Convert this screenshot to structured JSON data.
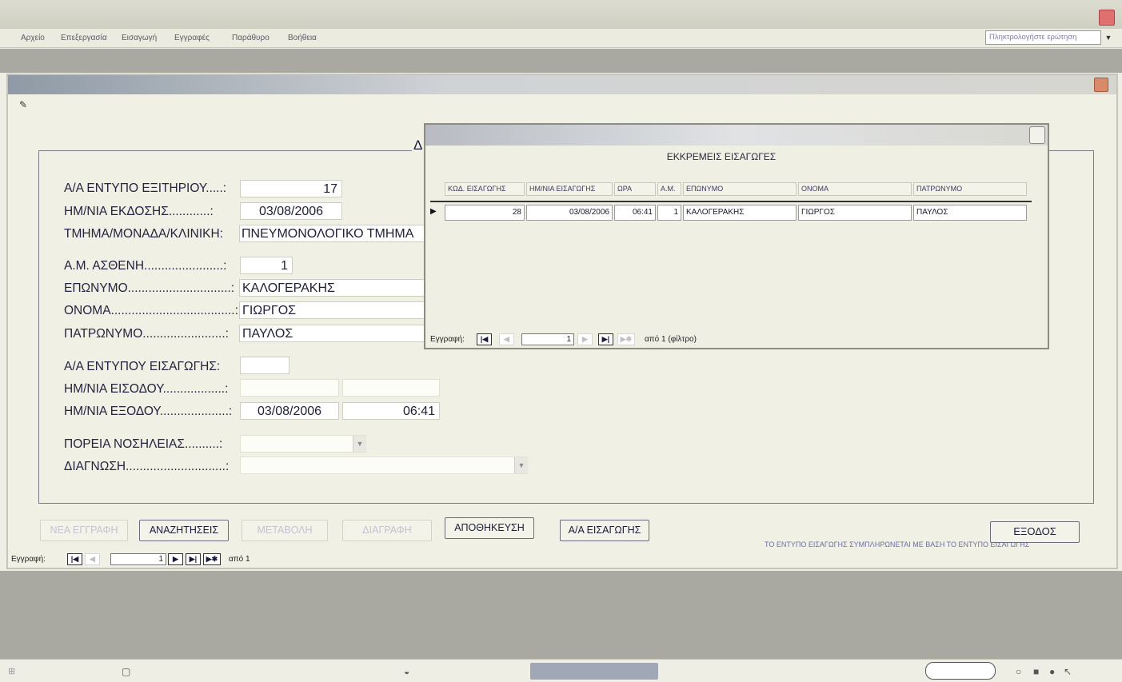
{
  "menu": {
    "items": [
      "Αρχείο",
      "Επεξεργασία",
      "Εισαγωγή",
      "Εγγραφές",
      "Παράθυρο",
      "Βοήθεια"
    ],
    "help_placeholder": "Πληκτρολογήστε ερώτηση"
  },
  "form": {
    "frame_letter": "Δ",
    "labels": {
      "exit_form_no": "Α/Α ΕΝΤΥΠΟ ΕΞΙΤΗΡΙΟΥ.....:",
      "issue_date": "ΗΜ/ΝΙΑ ΕΚΔΟΣΗΣ............:",
      "department": "ΤΜΗΜΑ/ΜΟΝΑΔΑ/ΚΛΙΝΙΚΗ:",
      "patient_id": "Α.Μ. ΑΣΘΕΝΗ.......................:",
      "surname": "ΕΠΩΝΥΜΟ..............................:",
      "name": "ΟΝΟΜΑ....................................:",
      "father_name": "ΠΑΤΡΩΝΥΜΟ........................:",
      "admission_form_no": "Α/Α ΕΝΤΥΠΟΥ ΕΙΣΑΓΩΓΗΣ:",
      "entry_date": "ΗΜ/ΝΙΑ ΕΙΣΟΔΟΥ..................:",
      "exit_date": "ΗΜ/ΝΙΑ ΕΞΟΔΟΥ....................:",
      "hospitalization_course": "ΠΟΡΕΙΑ ΝΟΣΗΛΕΙΑΣ..........:",
      "diagnosis": "ΔΙΑΓΝΩΣΗ.............................:"
    },
    "values": {
      "exit_form_no": "17",
      "issue_date": "03/08/2006",
      "department": "ΠΝΕΥΜΟΝΟΛΟΓΙΚΟ ΤΜΗΜΑ",
      "patient_id": "1",
      "surname": "ΚΑΛΟΓΕΡΑΚΗΣ",
      "name": "ΓΙΩΡΓΟΣ",
      "father_name": "ΠΑΥΛΟΣ",
      "admission_form_no": "",
      "entry_date": "",
      "entry_time": "",
      "exit_date": "03/08/2006",
      "exit_time": "06:41",
      "hospitalization_course": "",
      "diagnosis": ""
    },
    "note": "ΤΟ ΕΝΤΥΠΟ ΕΙΣΑΓΩΓΗΣ ΣΥΜΠΛΗΡΩΝΕΤΑΙ ΜΕ ΒΑΣΗ ΤΟ ΕΝΤΥΠΟ ΕΙΣΑΓΩΓΗΣ",
    "buttons": {
      "new": "ΝΕΑ ΕΓΓΡΑΦΗ",
      "search": "ΑΝΑΖΗΤΗΣΕΙΣ",
      "modify": "ΜΕΤΑΒΟΛΗ",
      "delete": "ΔΙΑΓΡΑΦΗ",
      "save": "ΑΠΟΘΗΚΕΥΣΗ",
      "admission_no": "Α/Α ΕΙΣΑΓΩΓΗΣ",
      "exit": "ΕΞΟΔΟΣ"
    },
    "nav": {
      "label": "Εγγραφή:",
      "current": "1",
      "of_text": "από 1"
    }
  },
  "popup": {
    "heading": "ΕΚΚΡΕΜΕΙΣ ΕΙΣΑΓΩΓΕΣ",
    "columns": [
      "ΚΩΔ. ΕΙΣΑΓΩΓΗΣ",
      "ΗΜ/ΝΙΑ ΕΙΣΑΓΩΓΗΣ",
      "ΩΡΑ",
      "Α.Μ.",
      "ΕΠΩΝΥΜΟ",
      "ΟΝΟΜΑ",
      "ΠΑΤΡΩΝΥΜΟ"
    ],
    "rows": [
      [
        "28",
        "03/08/2006",
        "06:41",
        "1",
        "ΚΑΛΟΓΕΡΑΚΗΣ",
        "ΓΙΩΡΓΟΣ",
        "ΠΑΥΛΟΣ"
      ]
    ],
    "nav": {
      "label": "Εγγραφή:",
      "current": "1",
      "of_text": "από 1 (φίλτρο)"
    }
  }
}
